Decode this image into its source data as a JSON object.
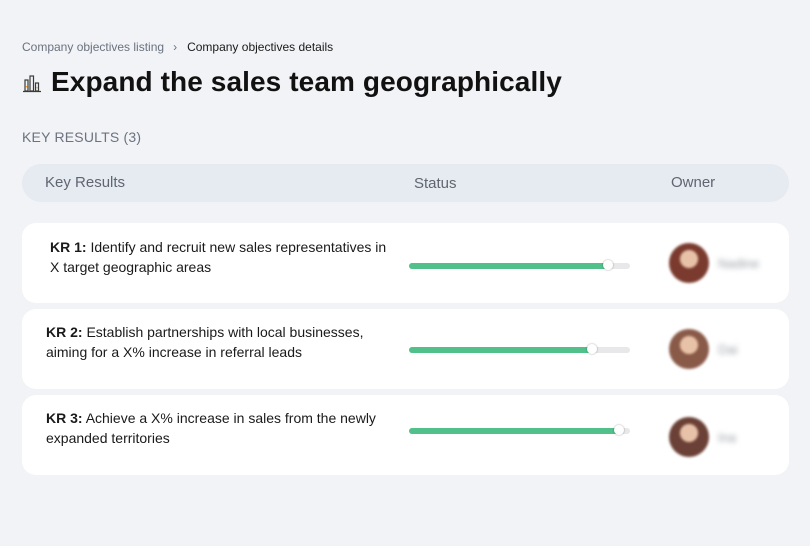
{
  "breadcrumb": {
    "parent": "Company objectives listing",
    "separator": "›",
    "current": "Company objectives details"
  },
  "objective": {
    "icon": "building-chart-icon",
    "title": "Expand the sales team geographically"
  },
  "key_results": {
    "section_label": "KEY RESULTS (3)",
    "columns": {
      "key_results": "Key Results",
      "status": "Status",
      "owner": "Owner"
    },
    "rows": [
      {
        "id": "KR 1:",
        "text": "Identify and recruit new sales representatives in X target geographic areas",
        "progress": 0.9,
        "owner": "Nadine",
        "avatar_color": "#7a3b2e"
      },
      {
        "id": "KR 2:",
        "text": "Establish partnerships with local businesses, aiming for a X% increase in referral leads",
        "progress": 0.83,
        "owner": "Dai",
        "avatar_color": "#8a5a48"
      },
      {
        "id": "KR 3:",
        "text": "Achieve a X% increase in sales from the newly expanded territories",
        "progress": 0.95,
        "owner": "Ina",
        "avatar_color": "#6b4036"
      }
    ]
  },
  "colors": {
    "progress_fill": "#52c08a",
    "progress_track": "#e8e8eb",
    "header_bg": "#e6eaf1",
    "page_bg": "#f2f3f6"
  }
}
